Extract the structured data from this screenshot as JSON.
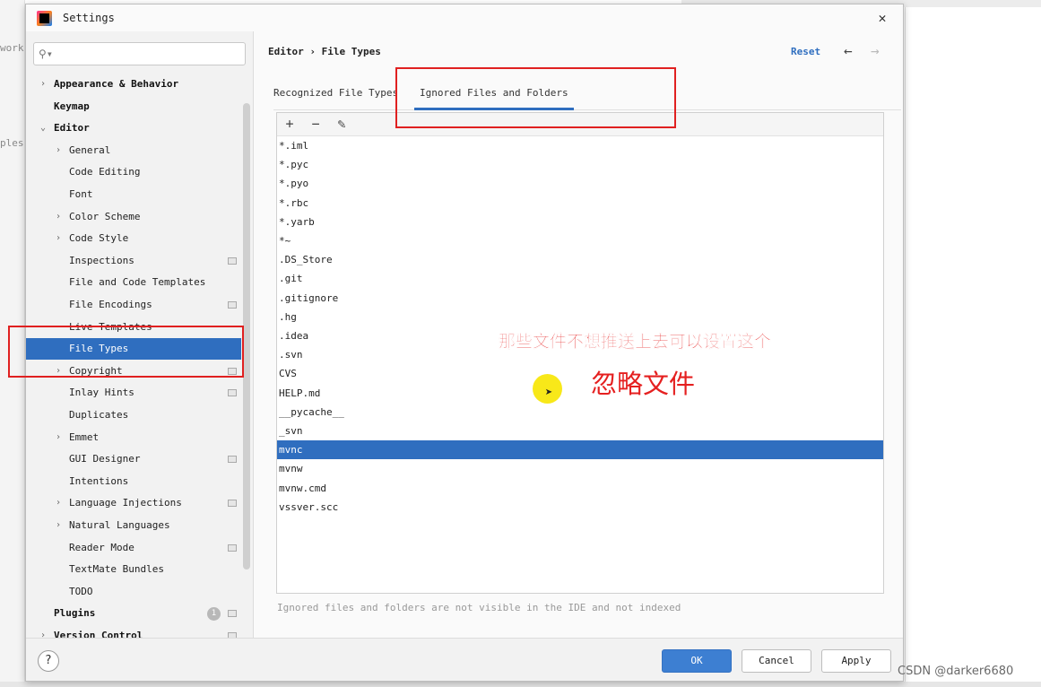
{
  "background": {
    "left_fragments": [
      "work",
      "ples"
    ],
    "watermark": "CSDN @darker6680"
  },
  "dialog": {
    "title": "Settings",
    "close_glyph": "✕"
  },
  "sidebar": {
    "search_placeholder": "",
    "items": [
      {
        "label": "Appearance & Behavior",
        "level": 0,
        "chevron": "›",
        "bold": true
      },
      {
        "label": "Keymap",
        "level": 0,
        "bold": true
      },
      {
        "label": "Editor",
        "level": 0,
        "chevron": "⌄",
        "bold": true
      },
      {
        "label": "General",
        "level": 1,
        "chevron": "›"
      },
      {
        "label": "Code Editing",
        "level": 1
      },
      {
        "label": "Font",
        "level": 1
      },
      {
        "label": "Color Scheme",
        "level": 1,
        "chevron": "›"
      },
      {
        "label": "Code Style",
        "level": 1,
        "chevron": "›"
      },
      {
        "label": "Inspections",
        "level": 1,
        "project": true
      },
      {
        "label": "File and Code Templates",
        "level": 1
      },
      {
        "label": "File Encodings",
        "level": 1,
        "project": true
      },
      {
        "label": "Live Templates",
        "level": 1
      },
      {
        "label": "File Types",
        "level": 1,
        "selected": true
      },
      {
        "label": "Copyright",
        "level": 1,
        "chevron": "›",
        "project": true
      },
      {
        "label": "Inlay Hints",
        "level": 1,
        "project": true
      },
      {
        "label": "Duplicates",
        "level": 1
      },
      {
        "label": "Emmet",
        "level": 1,
        "chevron": "›"
      },
      {
        "label": "GUI Designer",
        "level": 1,
        "project": true
      },
      {
        "label": "Intentions",
        "level": 1
      },
      {
        "label": "Language Injections",
        "level": 1,
        "chevron": "›",
        "project": true
      },
      {
        "label": "Natural Languages",
        "level": 1,
        "chevron": "›"
      },
      {
        "label": "Reader Mode",
        "level": 1,
        "project": true
      },
      {
        "label": "TextMate Bundles",
        "level": 1
      },
      {
        "label": "TODO",
        "level": 1
      },
      {
        "label": "Plugins",
        "level": 0,
        "bold": true,
        "badge": "1",
        "project": true
      },
      {
        "label": "Version Control",
        "level": 0,
        "chevron": "›",
        "bold": true,
        "project": true
      }
    ]
  },
  "main": {
    "breadcrumb": "Editor › File Types",
    "reset_label": "Reset",
    "back_glyph": "←",
    "forward_glyph": "→",
    "tabs": [
      {
        "label": "Recognized File Types",
        "active": false
      },
      {
        "label": "Ignored Files and Folders",
        "active": true
      }
    ],
    "toolbar": {
      "add": "+",
      "remove": "−",
      "edit": "✎"
    },
    "ignored": [
      "*.iml",
      "*.pyc",
      "*.pyo",
      "*.rbc",
      "*.yarb",
      "*~",
      ".DS_Store",
      ".git",
      ".gitignore",
      ".hg",
      ".idea",
      ".svn",
      "CVS",
      "HELP.md",
      "__pycache__",
      "_svn",
      "mvnc",
      "mvnw",
      "mvnw.cmd",
      "vssver.scc"
    ],
    "selected_index": 16,
    "hint": "Ignored files and folders are not visible in the IDE and not indexed"
  },
  "annotations": {
    "line1": "那些文件不想推送上去可以设置这个",
    "line2": "忽略文件",
    "highlight_color": "#e02020"
  },
  "footer": {
    "help": "?",
    "ok": "OK",
    "cancel": "Cancel",
    "apply": "Apply"
  }
}
